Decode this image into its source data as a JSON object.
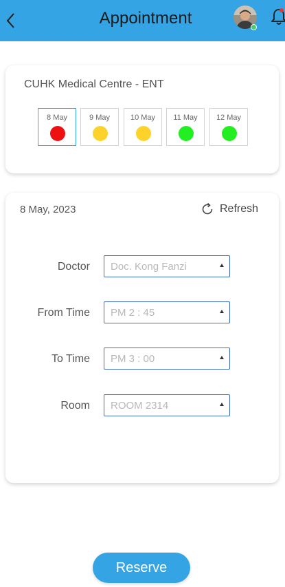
{
  "header": {
    "title": "Appointment",
    "back_icon": "chevron-left-icon",
    "notification_icon": "bell-icon"
  },
  "clinic": {
    "name": "CUHK Medical Centre - ENT",
    "dates": [
      {
        "label": "8 May",
        "status": "full",
        "color": "#ee1111",
        "selected": true
      },
      {
        "label": "9 May",
        "status": "limited",
        "color": "#fdd22b",
        "selected": false
      },
      {
        "label": "10 May",
        "status": "limited",
        "color": "#fdd22b",
        "selected": false
      },
      {
        "label": "11 May",
        "status": "available",
        "color": "#22ee22",
        "selected": false
      },
      {
        "label": "12 May",
        "status": "available",
        "color": "#22ee22",
        "selected": false
      }
    ]
  },
  "details": {
    "date": "8 May, 2023",
    "refresh_label": "Refresh",
    "fields": [
      {
        "label": "Doctor",
        "value": "Doc. Kong Fanzi"
      },
      {
        "label": "From Time",
        "value": "PM 2 : 45"
      },
      {
        "label": "To Time",
        "value": "PM 3 : 00"
      },
      {
        "label": "Room",
        "value": "ROOM 2314"
      }
    ]
  },
  "reserve_label": "Reserve",
  "colors": {
    "accent": "#35a4e4",
    "field_border": "#3b6bc4",
    "online": "#4ecb71",
    "badge": "#e53935"
  }
}
